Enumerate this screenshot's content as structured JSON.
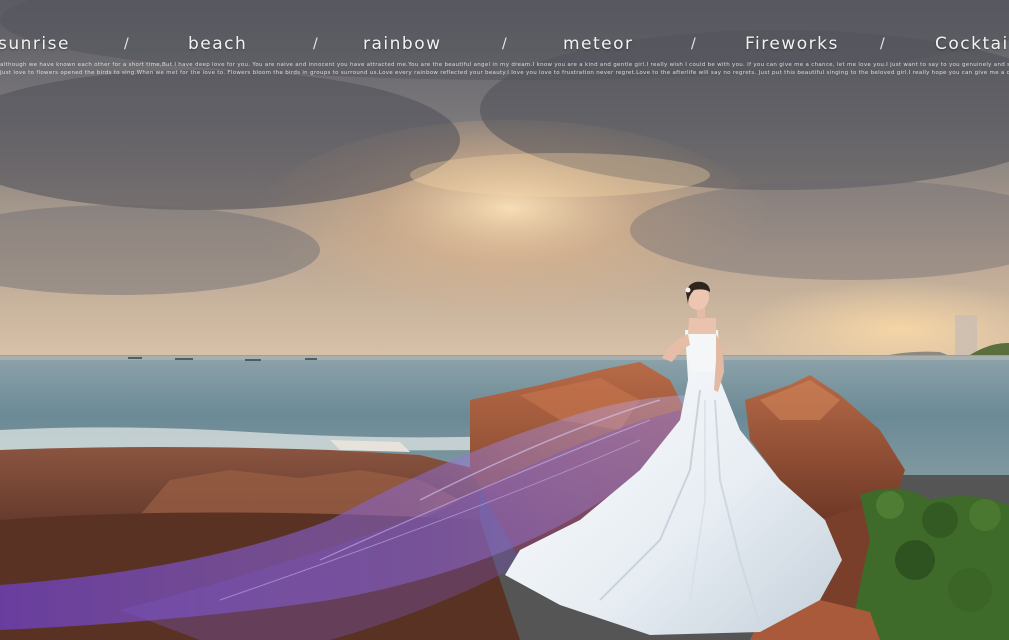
{
  "nav": {
    "items": [
      "sunrise",
      "beach",
      "rainbow",
      "meteor",
      "Fireworks",
      "Cocktai"
    ],
    "separator": "/"
  },
  "tagline": {
    "line1": "although we have known each other for a short time,But I have deep love for you. You are naive and innocent you have attracted me.You are the beautiful angel in my dream.I know you are a kind and gentle girl.I really wish I could be with you. If you can give me a chance, let me love you.I just want to say to you genuinely and sincerely I love you",
    "line2": "Just love to flowers opened the birds to sing.When we met for the love to. Flowers bloom the birds in groups to surround us.Love every rainbow reflected your beauty.I love you love to frustration never regret.Love to the afterlife will say no regrets. Just put this beautiful singing to the beloved girl.I really hope you can give me a chance. Let me love you"
  },
  "colors": {
    "sky_top": "#5f6068",
    "sky_glow": "#f3cf9a",
    "sea": "#6f8f9a",
    "rock": "#a8563a",
    "veil": "#7b55c4",
    "dress": "#eef2f6",
    "foliage": "#3e6a2a"
  }
}
